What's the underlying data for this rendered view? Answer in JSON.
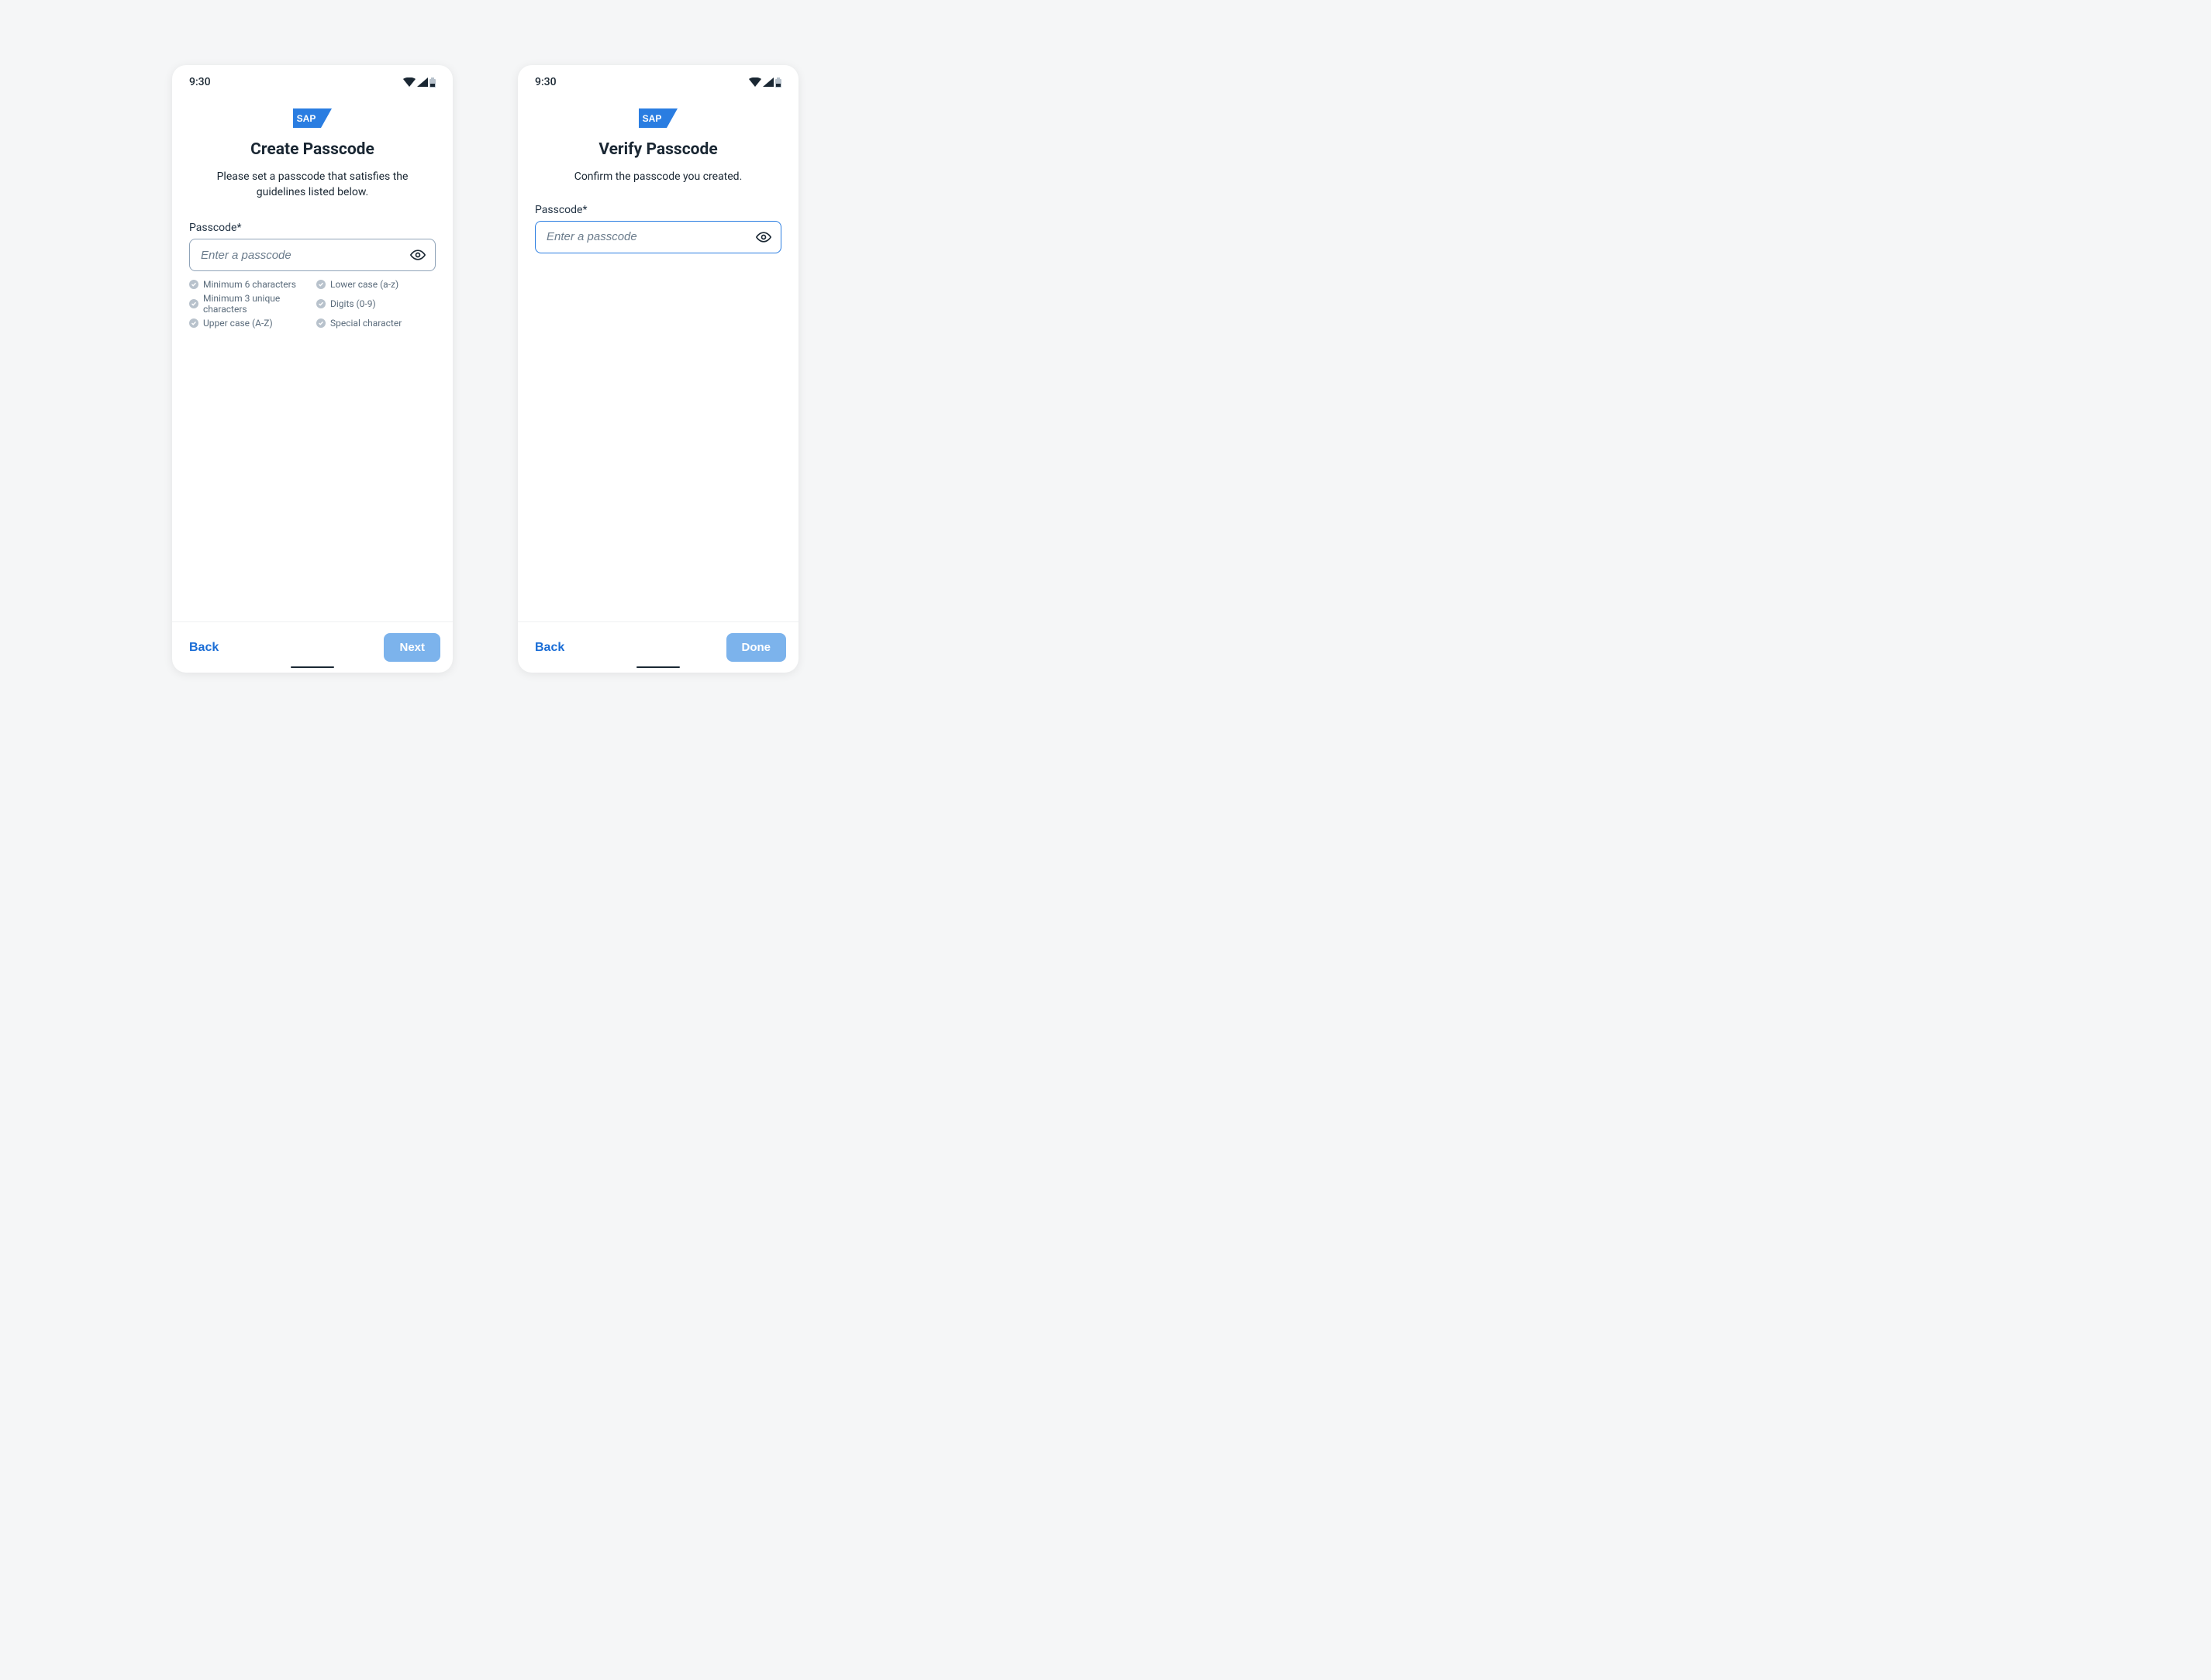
{
  "status": {
    "time": "9:30"
  },
  "logo": {
    "text": "SAP"
  },
  "screens": {
    "create": {
      "title": "Create Passcode",
      "subtitle": "Please set a passcode that satisfies the guidelines listed below.",
      "field_label": "Passcode*",
      "placeholder": "Enter a passcode",
      "rules": {
        "r0": "Minimum 6 characters",
        "r1": "Minimum 3 unique characters",
        "r2": "Upper case (A-Z)",
        "r3": "Lower case (a-z)",
        "r4": "Digits (0-9)",
        "r5": "Special character"
      },
      "back": "Back",
      "next": "Next"
    },
    "verify": {
      "title": "Verify Passcode",
      "subtitle": "Confirm the passcode you created.",
      "field_label": "Passcode*",
      "placeholder": "Enter a passcode",
      "back": "Back",
      "done": "Done"
    }
  }
}
